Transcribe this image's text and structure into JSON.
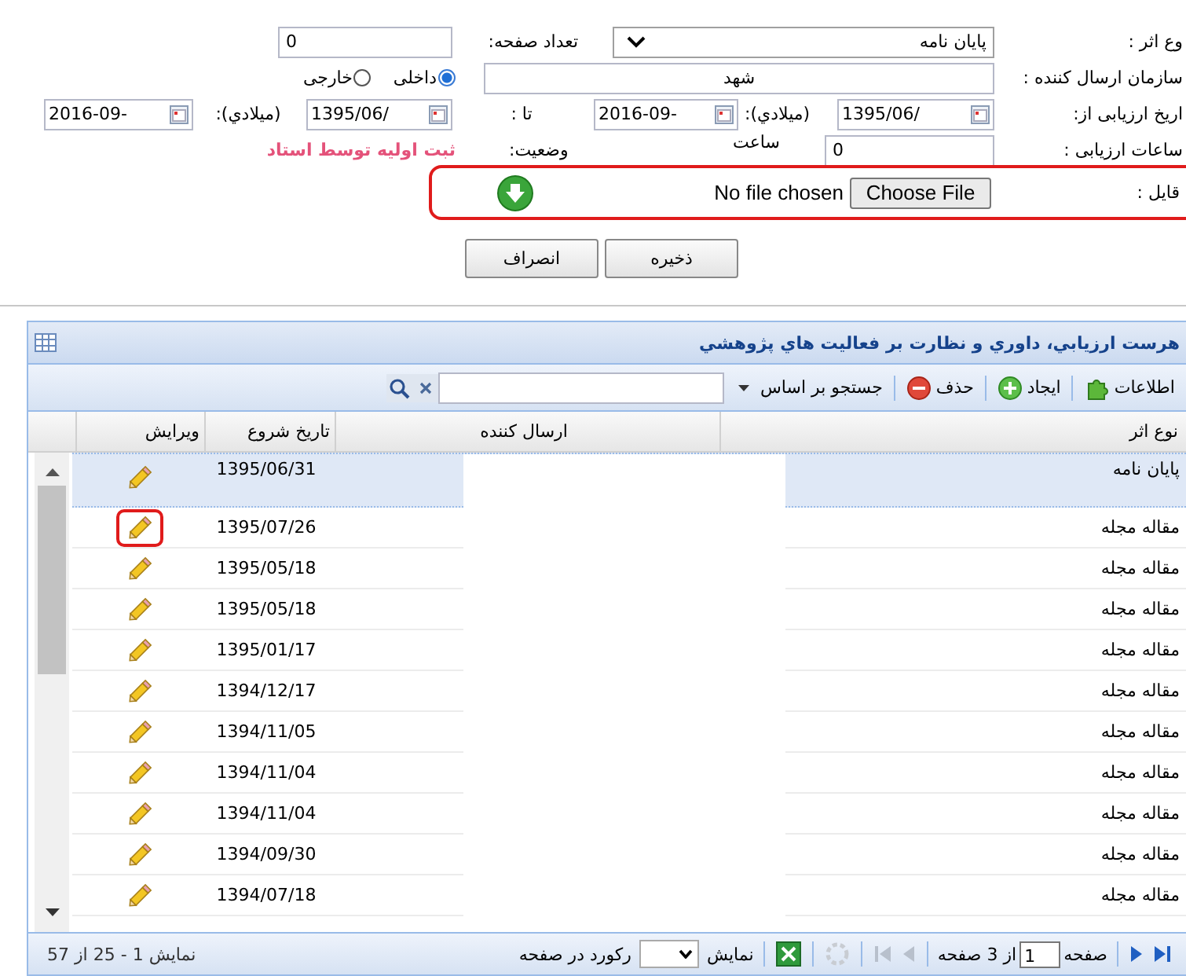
{
  "form": {
    "work_type": {
      "label": "وع اثر :",
      "value": "پایان نامه"
    },
    "page_count": {
      "label": "تعداد صفحه:",
      "value": "0"
    },
    "sender_org": {
      "label": "سازمان ارسال کننده :",
      "value": "شهد"
    },
    "origin": [
      {
        "label": "داخلی",
        "selected": true
      },
      {
        "label": "خارجی",
        "selected": false
      }
    ],
    "eval_date": {
      "label": "اریخ ارزیابی از:",
      "from_shamsi": "1395/06/",
      "gregorian_label_1": "(ميلادي):",
      "from_gregorian": "2016-09-",
      "to_label": "تا :",
      "to_shamsi": "1395/06/",
      "gregorian_label_2": "(ميلادي):",
      "to_gregorian": "2016-09-"
    },
    "hours": {
      "label": "ساعات ارزیابی :",
      "value": "0",
      "unit": "ساعت"
    },
    "status": {
      "label": "وضعیت:",
      "value": "ثبت اولیه توسط استاد"
    },
    "file": {
      "label": "قایل :",
      "button": "Choose File",
      "text": "No file chosen",
      "highlighted": true
    },
    "buttons": [
      "ذخیره",
      "انصراف"
    ]
  },
  "grid": {
    "title": "هرست ارزيابي، داوري و نظارت بر فعاليت هاي پژوهشي",
    "toolbar": [
      {
        "kind": "info",
        "label": "اطلاعات"
      },
      {
        "kind": "add",
        "label": "ایجاد"
      },
      {
        "kind": "delete",
        "label": "حذف"
      },
      {
        "kind": "search_by",
        "label": "جستجو بر اساس"
      },
      {
        "kind": "search"
      }
    ],
    "columns": [
      "نوع اثر",
      "ارسال کننده",
      "تاریخ شروع",
      "ویرایش"
    ],
    "rows": [
      {
        "type": "پایان نامه",
        "start_date": "1395/06/31",
        "selected": true,
        "highlighted": false
      },
      {
        "type": "مقاله مجله",
        "start_date": "1395/07/26",
        "selected": false,
        "highlighted": true
      },
      {
        "type": "مقاله مجله",
        "start_date": "1395/05/18",
        "selected": false,
        "highlighted": false
      },
      {
        "type": "مقاله مجله",
        "start_date": "1395/05/18",
        "selected": false,
        "highlighted": false
      },
      {
        "type": "مقاله مجله",
        "start_date": "1395/01/17",
        "selected": false,
        "highlighted": false
      },
      {
        "type": "مقاله مجله",
        "start_date": "1394/12/17",
        "selected": false,
        "highlighted": false
      },
      {
        "type": "مقاله مجله",
        "start_date": "1394/11/05",
        "selected": false,
        "highlighted": false
      },
      {
        "type": "مقاله مجله",
        "start_date": "1394/11/04",
        "selected": false,
        "highlighted": false
      },
      {
        "type": "مقاله مجله",
        "start_date": "1394/11/04",
        "selected": false,
        "highlighted": false
      },
      {
        "type": "مقاله مجله",
        "start_date": "1394/09/30",
        "selected": false,
        "highlighted": false
      },
      {
        "type": "مقاله مجله",
        "start_date": "1394/07/18",
        "selected": false,
        "highlighted": false
      }
    ],
    "pager": {
      "page_label": "صفحه",
      "page": "1",
      "of_pages": "از 3 صفحه",
      "show_label": "نمایش",
      "per_page_label": "رکورد در صفحه",
      "summary": "نمایش 1 - 25 از 57"
    }
  }
}
